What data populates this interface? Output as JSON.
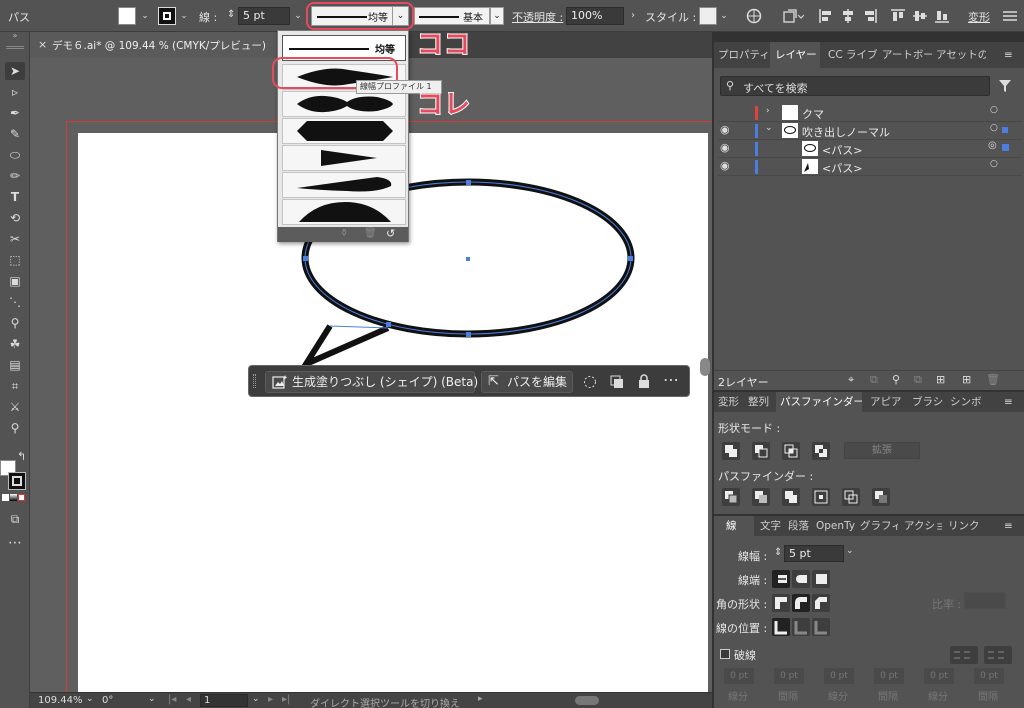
{
  "control_bar": {
    "selection_label": "パス",
    "stroke_label": "線 :",
    "stroke_width": "5 pt",
    "width_profile": "均等",
    "brush_label": "基本",
    "opacity_label": "不透明度 :",
    "opacity_value": "100%",
    "style_label": "スタイル :",
    "transform_label": "変形"
  },
  "document_tab": {
    "title": "デモ６.ai* @ 109.44 % (CMYK/プレビュー)",
    "close": "×"
  },
  "profile_dropdown": {
    "first_item": "均等",
    "tooltip": "線幅プロファイル 1",
    "footer_icons": [
      "delete-profile-icon",
      "trash-icon",
      "reset-icon"
    ]
  },
  "annotations": {
    "top": "ココ",
    "bottom": "コレ"
  },
  "context_bar": {
    "generative_fill": "生成塗りつぶし (シェイプ) (Beta)",
    "edit_path": "パスを編集"
  },
  "status_bar": {
    "zoom": "109.44%",
    "rotation": "0°",
    "artboard_number": "1",
    "status_text": "ダイレクト選択ツールを切り換え"
  },
  "layers_panel": {
    "tabs": [
      "プロパティ",
      "レイヤー",
      "CC ライブ",
      "アートボー",
      "アセットの"
    ],
    "active_tab": "レイヤー",
    "search_placeholder": "すべてを検索",
    "rows": [
      {
        "name": "クマ",
        "color": "#e0453c"
      },
      {
        "name": "吹き出しノーマル",
        "color": "#4a7fe0"
      },
      {
        "name": "<パス>",
        "color": "#4a7fe0"
      },
      {
        "name": "<パス>",
        "color": "#4a7fe0"
      }
    ],
    "footer_count": "2レイヤー"
  },
  "pathfinder_panel": {
    "tabs": [
      "変形",
      "整列",
      "パスファインダー",
      "アピア",
      "ブラシ",
      "シンボ"
    ],
    "active_tab": "パスファインダー",
    "shape_modes_label": "形状モード :",
    "expand_button": "拡張",
    "pathfinders_label": "パスファインダー :"
  },
  "stroke_panel": {
    "tabs": [
      "線",
      "文字",
      "段落",
      "OpenTy",
      "グラフィ",
      "アクショ",
      "リンク"
    ],
    "active_tab": "線",
    "weight_label": "線幅 :",
    "weight_value": "5 pt",
    "cap_label": "線端 :",
    "corner_label": "角の形状 :",
    "limit_label": "比率 :",
    "align_label": "線の位置 :",
    "dashed_label": "破線",
    "dash_fields": [
      "0 pt",
      "0 pt",
      "0 pt",
      "0 pt",
      "0 pt",
      "0 pt"
    ],
    "dash_labels": [
      "線分",
      "間隔",
      "線分",
      "間隔",
      "線分",
      "間隔"
    ]
  },
  "colors": {
    "accent_red": "#e54b5e",
    "selection_blue": "#4a7fe0"
  }
}
